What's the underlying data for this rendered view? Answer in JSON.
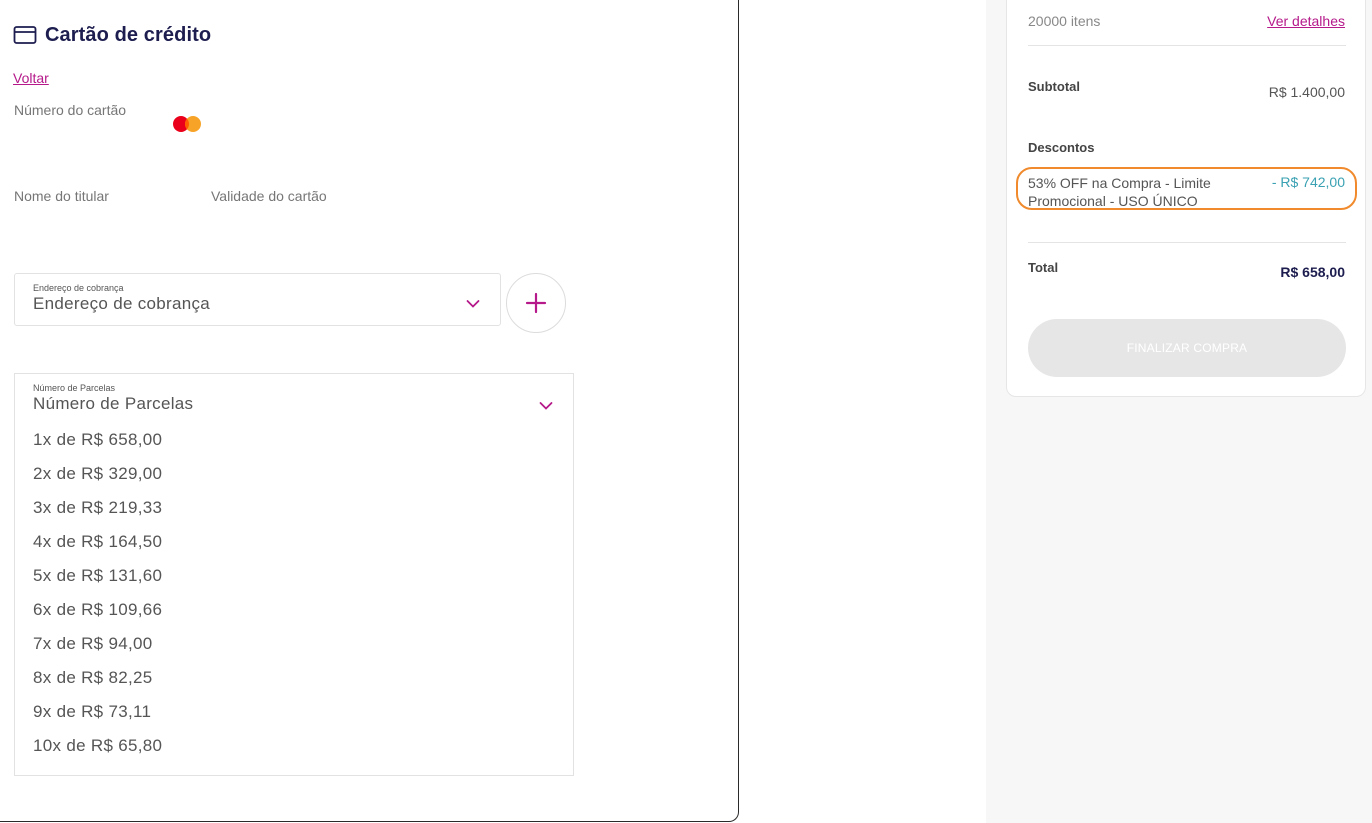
{
  "payment": {
    "title": "Cartão de crédito",
    "back_label": "Voltar",
    "card_number_label": "Número do cartão",
    "holder_label": "Nome do titular",
    "validity_label": "Validade do cartão",
    "billing_address": {
      "small_label": "Endereço de cobrança",
      "value": "Endereço de cobrança"
    },
    "installments": {
      "small_label": "Número de Parcelas",
      "value": "Número de Parcelas",
      "options": [
        "1x de R$ 658,00",
        "2x de R$ 329,00",
        "3x de R$ 219,33",
        "4x de R$ 164,50",
        "5x de R$ 131,60",
        "6x de R$ 109,66",
        "7x de R$ 94,00",
        "8x de R$ 82,25",
        "9x de R$ 73,11",
        "10x de R$ 65,80"
      ]
    }
  },
  "summary": {
    "items_count": "20000 itens",
    "details_link": "Ver detalhes",
    "subtotal_label": "Subtotal",
    "subtotal_value": "R$ 1.400,00",
    "discounts_label": "Descontos",
    "discount_name": "53% OFF na Compra - Limite Promocional - USO ÚNICO",
    "discount_value": "- R$ 742,00",
    "total_label": "Total",
    "total_value": "R$ 658,00",
    "finish_button": "FINALIZAR COMPRA"
  },
  "colors": {
    "accent": "#b5198a",
    "title": "#1d1d4f",
    "discount": "#3aa1b3",
    "highlight": "#f08a2c"
  },
  "icons": {
    "card": "credit-card-icon",
    "brand": "mastercard-icon",
    "chevron": "chevron-down-icon",
    "add": "plus-icon"
  }
}
